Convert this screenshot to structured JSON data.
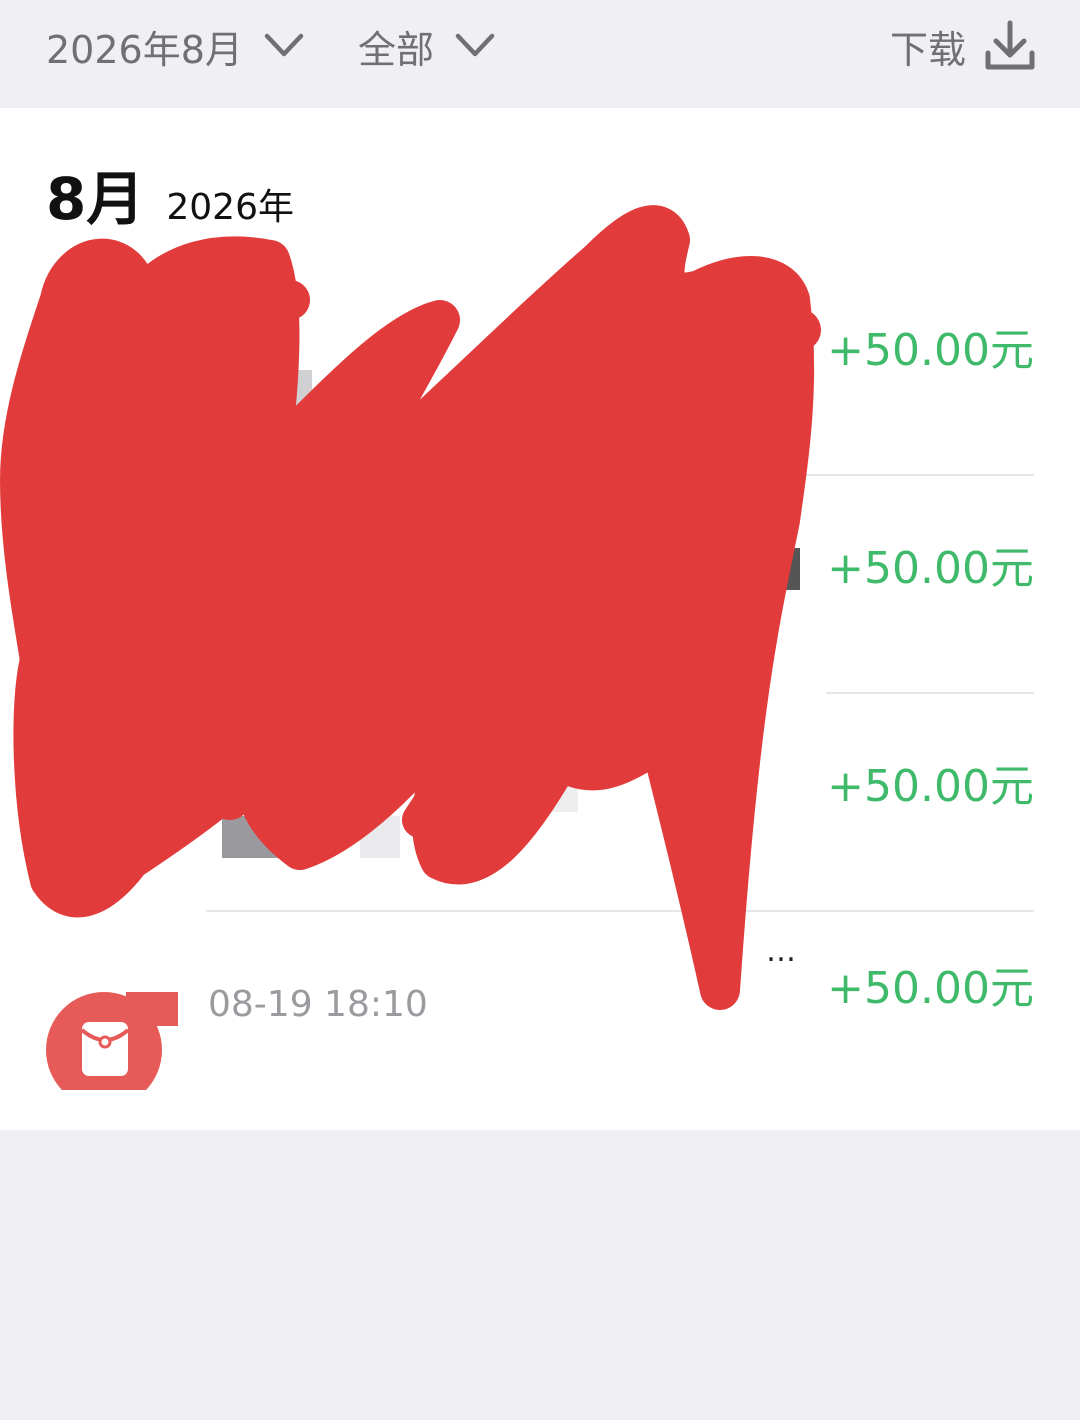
{
  "filters": {
    "month_label": "2026年8月",
    "type_label": "全部",
    "download_label": "下载",
    "chevron_icon": "chevron-down-icon",
    "download_icon": "download-icon"
  },
  "month_section": {
    "month": "8月",
    "year": "2026年"
  },
  "transactions": [
    {
      "amount": "+50.00元"
    },
    {
      "amount": "+50.00元"
    },
    {
      "amount": "+50.00元"
    },
    {
      "amount": "+50.00元",
      "time": "08-19 18:10",
      "title_suffix": "…",
      "icon": "red-packet-icon"
    }
  ],
  "colors": {
    "background": "#efeff4",
    "amount_positive": "#3fb96a",
    "red_packet": "#e65a58",
    "redaction": "#e23b3b"
  }
}
